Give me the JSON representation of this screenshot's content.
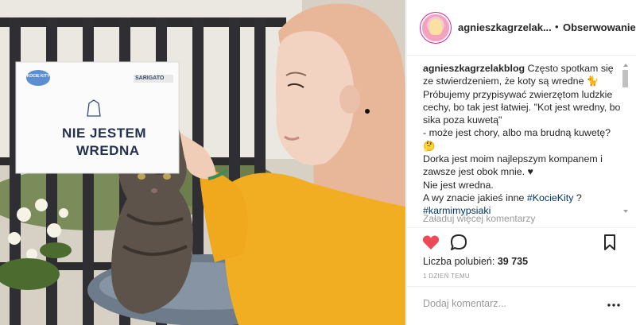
{
  "post": {
    "username": "agnieszkagrzelak...",
    "separator": "•",
    "follow_label": "Obserwowanie",
    "photo_sign": {
      "brand_left": "KOCIE KITY",
      "brand_right": "SARIGATO",
      "line1": "NIE JESTEM",
      "line2": "WREDNA"
    },
    "caption": {
      "user": "agnieszkagrzelakblog",
      "text1": " Często spotkam się ze stwierdzeniem, że koty są wredne ",
      "emoji1": "🐈",
      "text2": " Próbujemy przypisywać zwierzętom ludzkie cechy, bo tak jest łatwiej. \"Kot jest wredny, bo sika poza kuwetą\"",
      "text3": "- może jest chory, albo ma brudną kuwetę?",
      "emoji2": "🤔",
      "text4": "Dorka jest moim najlepszym kompanem i zawsze jest obok mnie. ",
      "heart": "♥",
      "text5": "Nie jest wredna.",
      "text6": "A wy znacie jakieś inne ",
      "hashtag1": "#KocieKity",
      "text7": " ?",
      "hashtag2": "#karmimypsiaki"
    },
    "load_more": "Załaduj więcej komentarzy",
    "likes_label": "Liczba polubień: ",
    "likes_count": "39 735",
    "date": "1 DZIEŃ TEMU",
    "comment_placeholder": "Dodaj komentarz...",
    "colors": {
      "like": "#ed4956",
      "text": "#262626",
      "muted": "#999999",
      "link": "#003569"
    },
    "icons": [
      "avatar",
      "heart-icon",
      "comment-icon",
      "bookmark-icon",
      "more-options-icon"
    ]
  }
}
